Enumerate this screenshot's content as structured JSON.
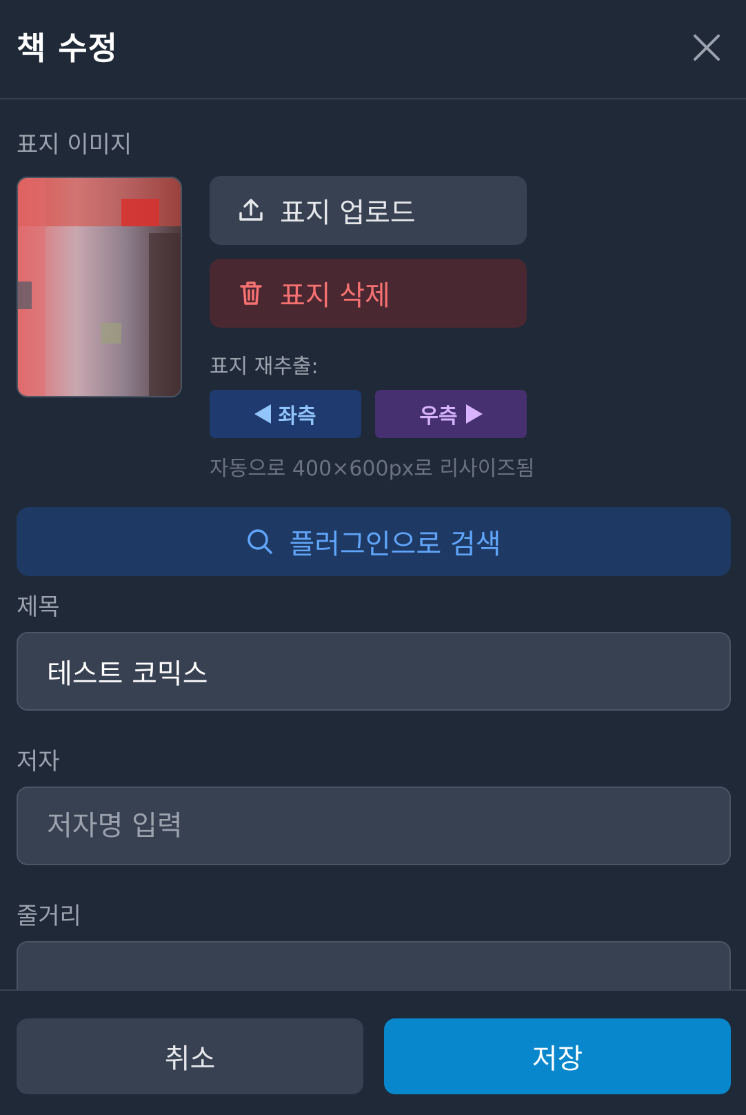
{
  "header": {
    "title": "책 수정",
    "close_icon": "close-icon"
  },
  "cover": {
    "label": "표지 이미지",
    "upload_label": "표지 업로드",
    "delete_label": "표지 삭제",
    "reextract_label": "표지 재추출:",
    "left_label": "좌측",
    "right_label": "우측",
    "resize_note": "자동으로 400×600px로 리사이즈됨"
  },
  "search": {
    "label": "플러그인으로 검색",
    "icon": "search-icon"
  },
  "fields": {
    "title_label": "제목",
    "title_value": "테스트 코믹스",
    "author_label": "저자",
    "author_placeholder": "저자명 입력",
    "summary_label": "줄거리"
  },
  "footer": {
    "cancel_label": "취소",
    "save_label": "저장"
  },
  "colors": {
    "background": "#1f2937",
    "save": "#0987cc",
    "delete_text": "#f87171",
    "search_text": "#60a5fa",
    "left_button": "#1e3a6e",
    "right_button": "#46306f"
  }
}
